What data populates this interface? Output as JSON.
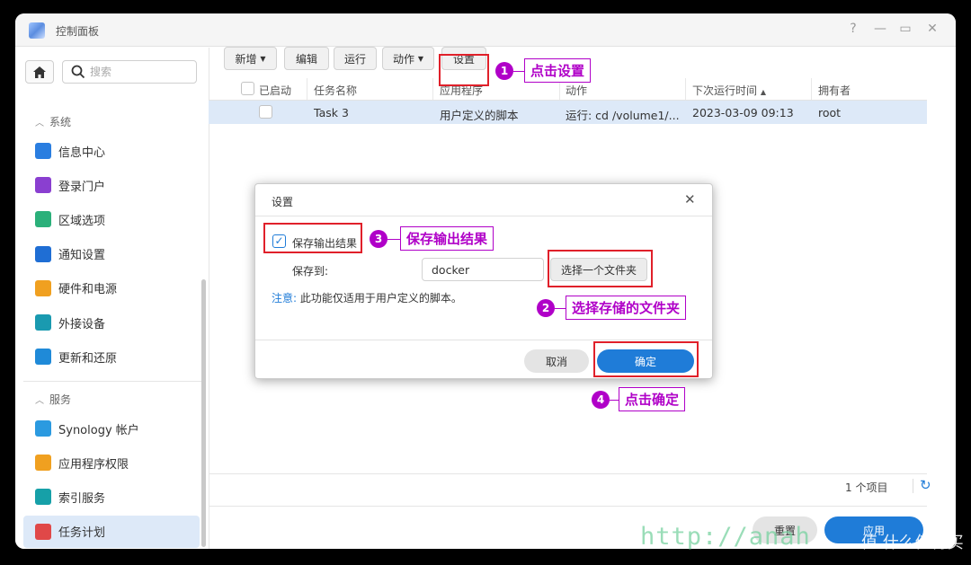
{
  "window": {
    "title": "控制面板",
    "controls": [
      "?",
      "—",
      "▭",
      "✕"
    ]
  },
  "search": {
    "placeholder": "搜索"
  },
  "sidebar": {
    "section_system": "系统",
    "system_items": [
      {
        "label": "信息中心",
        "icon": "info-icon",
        "color": "#2a7ee0"
      },
      {
        "label": "登录门户",
        "icon": "login-portal-icon",
        "color": "#8a3fd0"
      },
      {
        "label": "区域选项",
        "icon": "region-icon",
        "color": "#2bb07a"
      },
      {
        "label": "通知设置",
        "icon": "notification-icon",
        "color": "#1f6ed4"
      },
      {
        "label": "硬件和电源",
        "icon": "bulb-icon",
        "color": "#f0a020"
      },
      {
        "label": "外接设备",
        "icon": "external-device-icon",
        "color": "#1a9ab0"
      },
      {
        "label": "更新和还原",
        "icon": "update-icon",
        "color": "#1f8ad8"
      }
    ],
    "section_services": "服务",
    "service_items": [
      {
        "label": "Synology 帐户",
        "icon": "account-icon",
        "color": "#2b9ae0"
      },
      {
        "label": "应用程序权限",
        "icon": "lock-icon",
        "color": "#f0a020"
      },
      {
        "label": "索引服务",
        "icon": "index-search-icon",
        "color": "#16a0a8"
      },
      {
        "label": "任务计划",
        "icon": "calendar-icon",
        "color": "#e04848",
        "active": true
      }
    ]
  },
  "toolbar": {
    "new": "新增",
    "edit": "编辑",
    "run": "运行",
    "action": "动作",
    "settings": "设置"
  },
  "table": {
    "columns": [
      "已启动",
      "任务名称",
      "应用程序",
      "动作",
      "下次运行时间",
      "拥有者"
    ],
    "rows": [
      {
        "name": "Task 3",
        "app": "用户定义的脚本",
        "action": "运行: cd /volume1/...",
        "next_run": "2023-03-09 09:13",
        "owner": "root"
      }
    ],
    "count": "1 个项目"
  },
  "footer": {
    "reset": "重置",
    "apply": "应用"
  },
  "dialog": {
    "title": "设置",
    "save_output": "保存输出结果",
    "save_to": "保存到:",
    "folder_value": "docker",
    "choose_folder": "选择一个文件夹",
    "note_prefix": "注意:",
    "note_text": " 此功能仅适用于用户定义的脚本。",
    "cancel": "取消",
    "ok": "确定"
  },
  "annotations": [
    {
      "num": "1",
      "text": "点击设置"
    },
    {
      "num": "2",
      "text": "选择存储的文件夹"
    },
    {
      "num": "3",
      "text": "保存输出结果"
    },
    {
      "num": "4",
      "text": "点击确定"
    }
  ],
  "watermark": {
    "url": "http://anah",
    "brand": "值 什么值得买"
  },
  "colors": {
    "accent": "#1f7cd8",
    "annotation": "#b000c8",
    "highlight_box": "#e0202a",
    "selected_row": "#dde9f8"
  }
}
